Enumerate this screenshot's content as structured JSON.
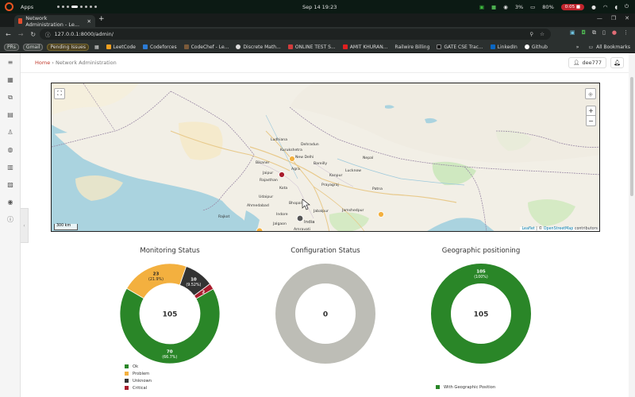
{
  "os_bar": {
    "apps_label": "Apps",
    "clock": "Sep 14  19:23",
    "cpu": "3%",
    "battery": "80%",
    "rec_time": "0:05"
  },
  "browser": {
    "tab_title": "Network Administration - Le...",
    "url": "127.0.0.1:8000/admin/",
    "bookmarks": [
      {
        "label": "PRs",
        "color": "#3d6b4a"
      },
      {
        "label": "Gmail",
        "color": "#8a8f8c"
      },
      {
        "label": "Pending Issues",
        "color": "#b5922b"
      },
      {
        "label": "LeetCode",
        "color": "#f0a020"
      },
      {
        "label": "Codeforces",
        "color": "#2b7bd6"
      },
      {
        "label": "CodeChef - Le...",
        "color": "#7b5a3a"
      },
      {
        "label": "Discrete Math...",
        "color": "#dddddd"
      },
      {
        "label": "ONLINE TEST S...",
        "color": "#d23c3c"
      },
      {
        "label": "AMIT KHURAN...",
        "color": "#e02020"
      },
      {
        "label": "Railwire Billing",
        "color": "#cccccc"
      },
      {
        "label": "GATE CSE Trac...",
        "color": "#333333"
      },
      {
        "label": "LinkedIn",
        "color": "#0a66c2"
      },
      {
        "label": "Github",
        "color": "#ffffff"
      }
    ],
    "more_label": "»",
    "all_bookmarks": "All Bookmarks"
  },
  "header": {
    "home": "Home",
    "separator": "›",
    "page": "Network Administration",
    "user": "dee777"
  },
  "map": {
    "scale_label": "300 km",
    "zoom_in": "+",
    "zoom_out": "−",
    "attribution_leaflet": "Leaflet",
    "attribution_sep": " | © ",
    "attribution_osm": "OpenStreetMap",
    "attribution_tail": " contributors",
    "places": [
      "Ludhiana",
      "Dehradun",
      "Kurukshetra",
      "New Delhi",
      "Bareilly",
      "Agra",
      "Kanpur",
      "Lucknow",
      "Kota",
      "Prayagraj",
      "Patna",
      "Bikaner",
      "Ahmedabad",
      "Udaipur",
      "Bhopal",
      "Jabalpur",
      "Indore",
      "Jamshedpur",
      "Jalgaon",
      "Amravati",
      "Rajasthan",
      "India",
      "Nepal",
      "Rajkot",
      "Jaipur"
    ]
  },
  "charts": {
    "monitoring": {
      "title": "Monitoring Status",
      "center": "105",
      "legend": [
        {
          "label": "Ok",
          "color": "#2a8628"
        },
        {
          "label": "Problem",
          "color": "#f3b03f"
        },
        {
          "label": "Unknown",
          "color": "#333333"
        },
        {
          "label": "Critical",
          "color": "#a81c2c"
        }
      ]
    },
    "configuration": {
      "title": "Configuration Status",
      "center": "0"
    },
    "geographic": {
      "title": "Geographic positioning",
      "center": "105",
      "legend": [
        {
          "label": "With Geographic Position",
          "color": "#2a8628"
        }
      ]
    }
  },
  "chart_data": [
    {
      "type": "pie",
      "title": "Monitoring Status",
      "categories": [
        "Ok",
        "Problem",
        "Unknown",
        "Critical"
      ],
      "values": [
        70,
        23,
        10,
        2
      ],
      "labels": [
        "70\n(66.7%)",
        "23\n(21.9%)",
        "10\n(9.52%)",
        "2"
      ],
      "colors": [
        "#2a8628",
        "#f3b03f",
        "#333333",
        "#a81c2c"
      ],
      "total": 105
    },
    {
      "type": "pie",
      "title": "Configuration Status",
      "categories": [],
      "values": [],
      "total": 0
    },
    {
      "type": "pie",
      "title": "Geographic positioning",
      "categories": [
        "With Geographic Position"
      ],
      "values": [
        105
      ],
      "labels": [
        "105\n(100%)"
      ],
      "colors": [
        "#2a8628"
      ],
      "total": 105
    }
  ]
}
